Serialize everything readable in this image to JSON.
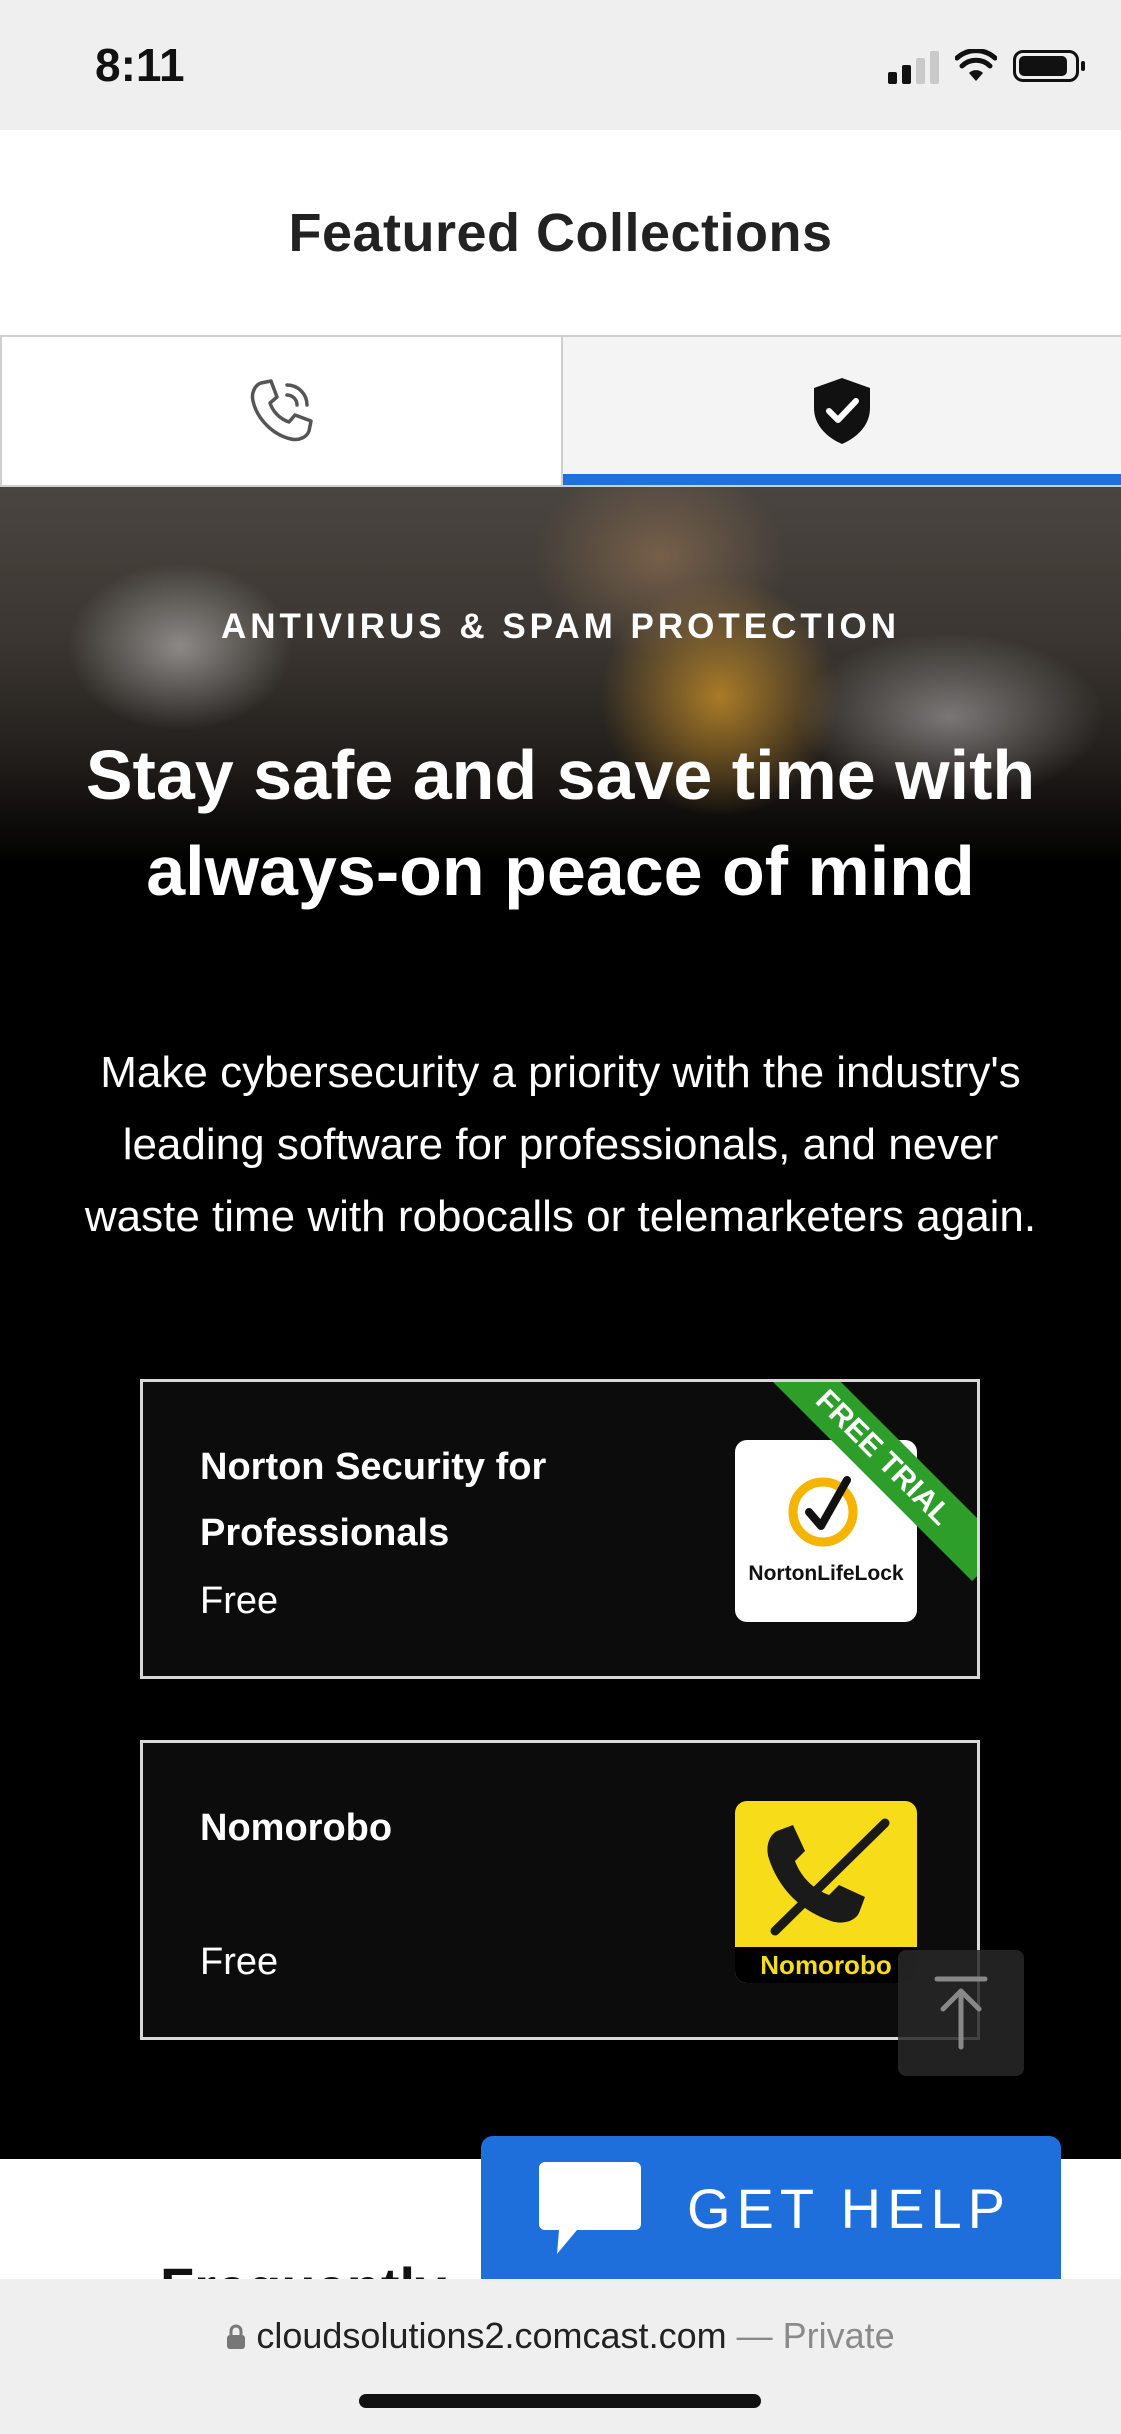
{
  "status_bar": {
    "time": "8:11"
  },
  "header": {
    "title": "Featured Collections"
  },
  "tabs": [
    {
      "icon": "phone-icon"
    },
    {
      "icon": "shield-check-icon",
      "active": true
    }
  ],
  "hero": {
    "eyebrow": "ANTIVIRUS & SPAM PROTECTION",
    "headline": "Stay safe and save time with always-on peace of mind",
    "body": "Make cybersecurity a priority with the industry's leading software for professionals, and never waste time with robocalls or telemarketers again."
  },
  "products": [
    {
      "name": "Norton Security for Professionals",
      "price": "Free",
      "badge": "FREE TRIAL",
      "logo_text": "NortonLifeLock"
    },
    {
      "name": "Nomorobo",
      "price": "Free",
      "logo_text": "Nomorobo"
    }
  ],
  "faq": {
    "heading": "Frequently"
  },
  "help_button": {
    "label": "GET HELP"
  },
  "browser": {
    "url": "cloudsolutions2.comcast.com",
    "mode": "— Private"
  },
  "colors": {
    "accent": "#1f6fde",
    "ribbon": "#2e9e2a",
    "nomorobo_yellow": "#f7dd19"
  }
}
